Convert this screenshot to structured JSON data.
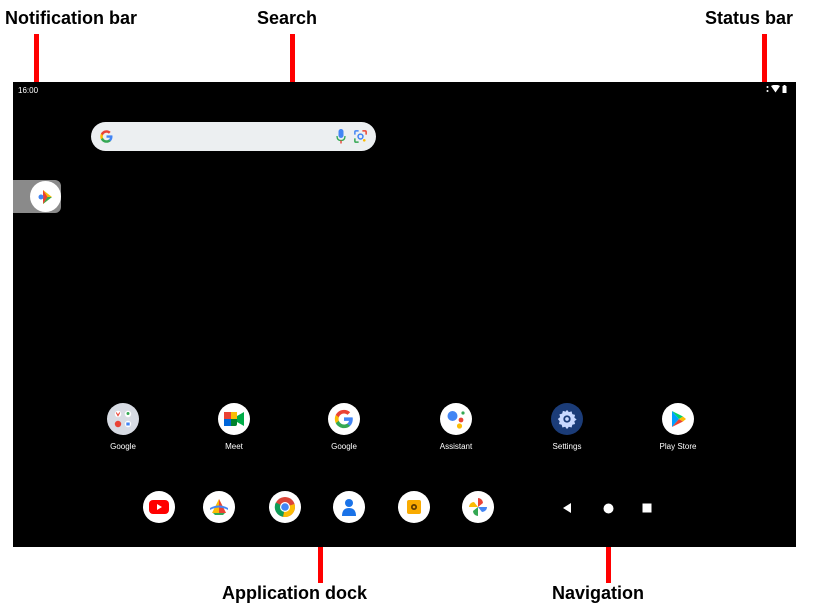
{
  "callouts": {
    "notification_bar": "Notification bar",
    "search": "Search",
    "status_bar": "Status bar",
    "application_dock": "Application dock",
    "navigation": "Navigation"
  },
  "status": {
    "time": "16:00",
    "icons": [
      "dots-icon",
      "wifi-icon",
      "battery-icon"
    ]
  },
  "search": {
    "icons": [
      "google-g-icon",
      "mic-icon",
      "lens-icon"
    ]
  },
  "side_tab": {
    "icon": "assistant-shortcut-icon"
  },
  "apps": [
    {
      "label": "Google",
      "icon": "google-folder-icon"
    },
    {
      "label": "Meet",
      "icon": "meet-icon"
    },
    {
      "label": "Google",
      "icon": "google-icon"
    },
    {
      "label": "Assistant",
      "icon": "assistant-icon"
    },
    {
      "label": "Settings",
      "icon": "settings-icon"
    },
    {
      "label": "Play Store",
      "icon": "play-store-icon"
    }
  ],
  "dock": [
    "youtube-icon",
    "google-news-icon",
    "chrome-icon",
    "contacts-icon",
    "files-icon",
    "photos-icon"
  ],
  "navigation": [
    "back-icon",
    "home-icon",
    "recents-icon"
  ],
  "colors": {
    "annotation": "#ff0000",
    "screen": "#000000"
  }
}
